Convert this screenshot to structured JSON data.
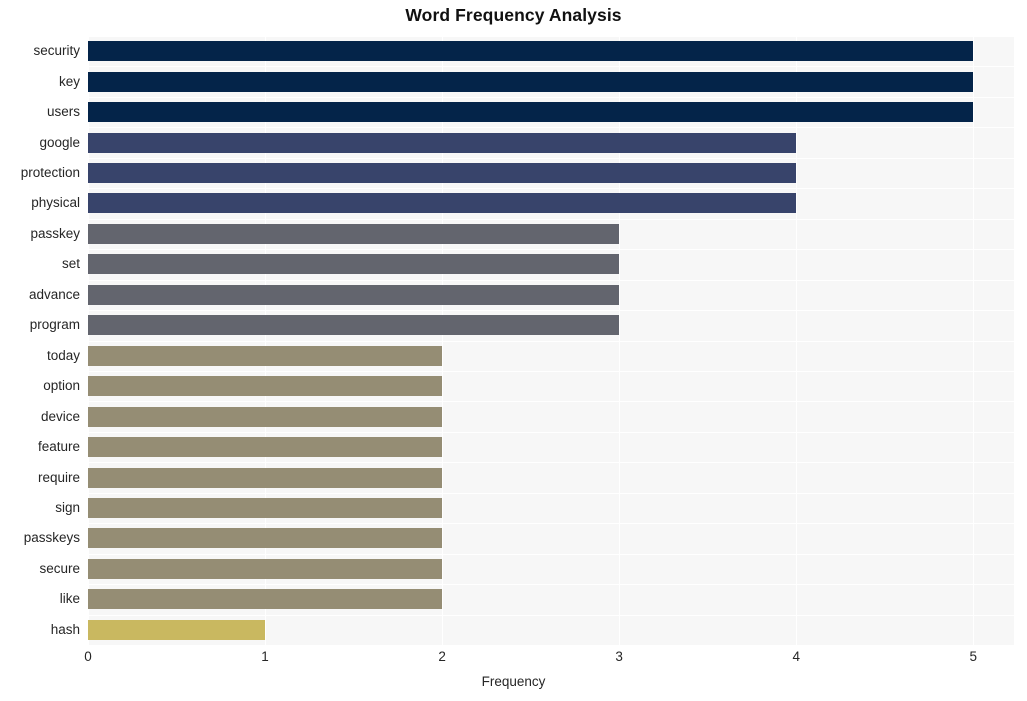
{
  "chart_data": {
    "type": "bar",
    "orientation": "horizontal",
    "title": "Word Frequency Analysis",
    "xlabel": "Frequency",
    "ylabel": "",
    "categories": [
      "security",
      "key",
      "users",
      "google",
      "protection",
      "physical",
      "passkey",
      "set",
      "advance",
      "program",
      "today",
      "option",
      "device",
      "feature",
      "require",
      "sign",
      "passkeys",
      "secure",
      "like",
      "hash"
    ],
    "values": [
      5,
      5,
      5,
      4,
      4,
      4,
      3,
      3,
      3,
      3,
      2,
      2,
      2,
      2,
      2,
      2,
      2,
      2,
      2,
      1
    ],
    "bar_colors": [
      "#042449",
      "#042449",
      "#042449",
      "#38446b",
      "#38446b",
      "#38446b",
      "#63656e",
      "#63656e",
      "#63656e",
      "#63656e",
      "#958d74",
      "#958d74",
      "#958d74",
      "#958d74",
      "#958d74",
      "#958d74",
      "#958d74",
      "#958d74",
      "#958d74",
      "#c9b860"
    ],
    "xlim": [
      0,
      5.23
    ],
    "xticks": [
      0,
      1,
      2,
      3,
      4,
      5
    ],
    "xtick_labels": [
      "0",
      "1",
      "2",
      "3",
      "4",
      "5"
    ],
    "grid": true,
    "grid_color": "#ffffff",
    "plot_background": "#f7f7f7",
    "figure_background": "#ffffff",
    "legend": null
  },
  "colors": {
    "title_text": "#111111",
    "tick_text": "#262626",
    "plot_bg": "#f7f7f7",
    "grid": "#ffffff",
    "page_bg": "#ffffff"
  }
}
